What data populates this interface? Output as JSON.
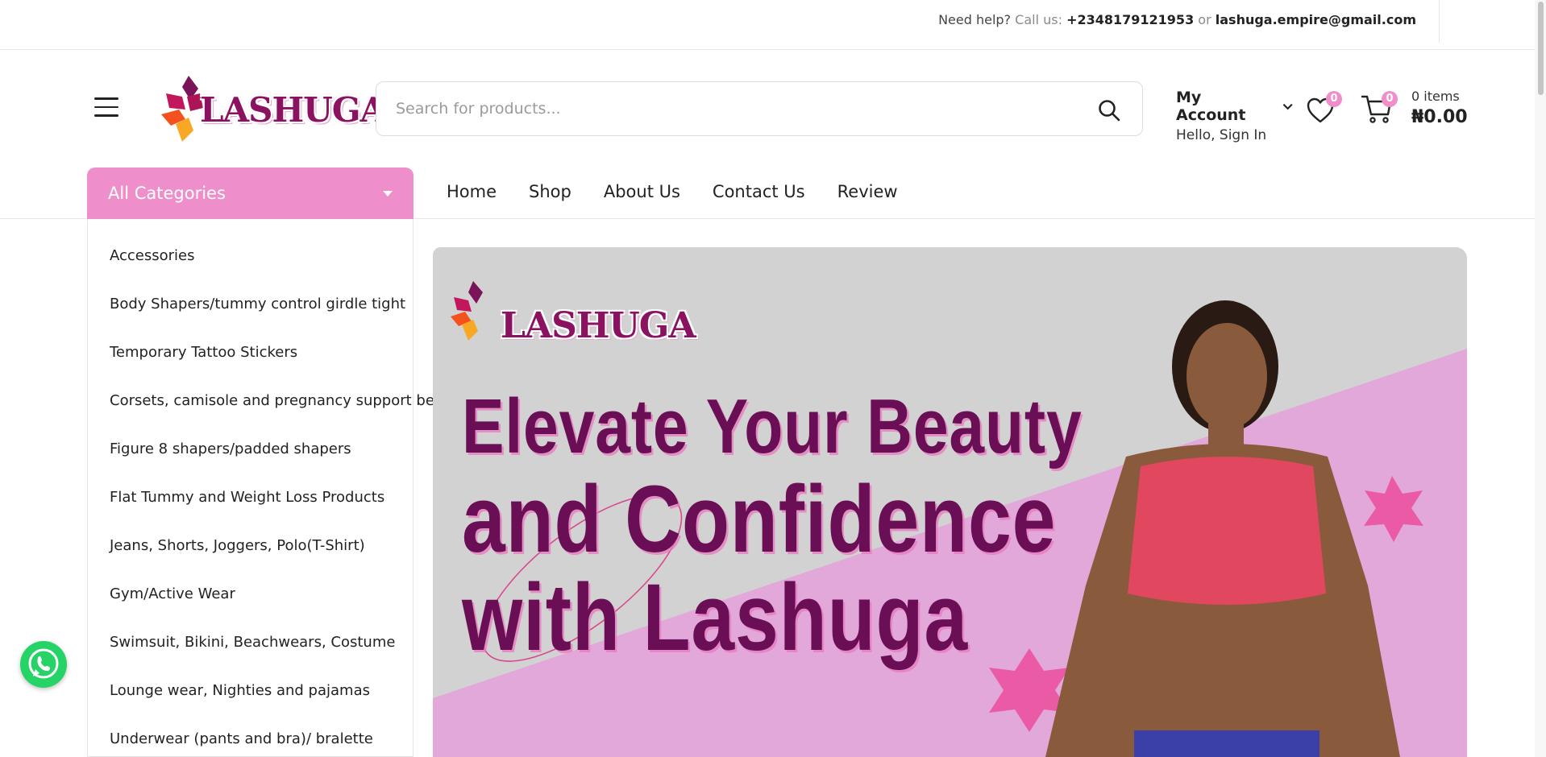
{
  "topbar": {
    "help_prefix": "Need help?",
    "call_label": "Call us:",
    "phone": "+2348179121953",
    "or_label": "or",
    "email": "lashuga.empire@gmail.com"
  },
  "header": {
    "logo_text": "LASHUGA",
    "search_placeholder": "Search for products...",
    "account_title": "My Account",
    "account_sub": "Hello, Sign In",
    "wishlist_count": "0",
    "cart_count": "0",
    "cart_items": "0 items",
    "cart_total": "₦0.00"
  },
  "nav": {
    "categories_label": "All Categories",
    "links": [
      "Home",
      "Shop",
      "About Us",
      "Contact Us",
      "Review"
    ]
  },
  "categories": [
    "Accessories",
    "Body Shapers/tummy control girdle tight",
    "Temporary Tattoo Stickers",
    "Corsets, camisole and pregnancy support belt",
    "Figure 8 shapers/padded shapers",
    "Flat Tummy and Weight Loss Products",
    "Jeans, Shorts, Joggers, Polo(T-Shirt)",
    "Gym/Active Wear",
    "Swimsuit, Bikini, Beachwears, Costume",
    "Lounge wear, Nighties and pajamas",
    "Underwear (pants and bra)/ bralette"
  ],
  "hero": {
    "logo_text": "LASHUGA",
    "line1": "Elevate Your Beauty",
    "line2": "and Confidence",
    "line3": "with Lashuga"
  },
  "colors": {
    "accent_pink": "#ee8fcb",
    "brand_purple": "#6a0f55",
    "whatsapp_green": "#25d366"
  },
  "icons": [
    "menu-icon",
    "search-icon",
    "chevron-down-icon",
    "heart-icon",
    "cart-icon",
    "whatsapp-icon"
  ]
}
